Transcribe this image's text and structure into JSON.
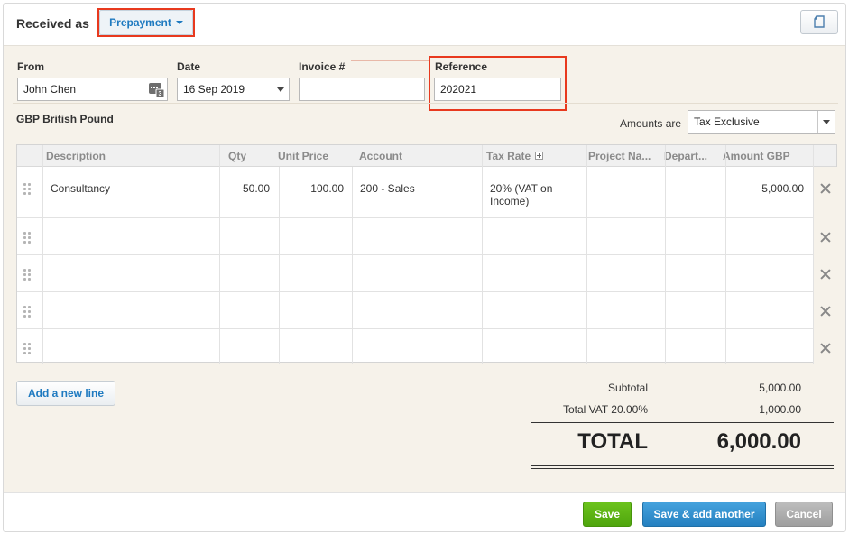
{
  "header": {
    "received_as_label": "Received as",
    "received_as_value": "Prepayment"
  },
  "fields": {
    "from_label": "From",
    "from_value": "John Chen",
    "date_label": "Date",
    "date_value": "16 Sep 2019",
    "invoice_label": "Invoice #",
    "invoice_value": "",
    "reference_label": "Reference",
    "reference_value": "202021"
  },
  "currency": "GBP British Pound",
  "amounts": {
    "label": "Amounts are",
    "value": "Tax Exclusive"
  },
  "table": {
    "columns": [
      "Description",
      "Qty",
      "Unit Price",
      "Account",
      "Tax Rate",
      "Project Na...",
      "Depart...",
      "Amount GBP"
    ],
    "rows": [
      {
        "description": "Consultancy",
        "qty": "50.00",
        "unit_price": "100.00",
        "account": "200 - Sales",
        "tax_rate": "20% (VAT on Income)",
        "project": "",
        "department": "",
        "amount": "5,000.00"
      }
    ]
  },
  "add_line_label": "Add a new line",
  "totals": {
    "subtotal_label": "Subtotal",
    "subtotal_value": "5,000.00",
    "vat_label": "Total VAT 20.00%",
    "vat_value": "1,000.00",
    "total_label": "TOTAL",
    "total_value": "6,000.00"
  },
  "footer": {
    "save_label": "Save",
    "save_add_label": "Save & add another",
    "cancel_label": "Cancel"
  },
  "colors": {
    "highlight": "#e8391e",
    "save": "#5bb311",
    "save_add": "#2e8bc9",
    "cancel": "#a9a9a9",
    "link_blue": "#1f7ac0"
  },
  "icons": {
    "contact": "contact-card-icon",
    "copy": "copy-document-icon",
    "drag": "drag-handle-icon",
    "delete": "delete-x-icon",
    "expand": "expand-plus-icon"
  }
}
